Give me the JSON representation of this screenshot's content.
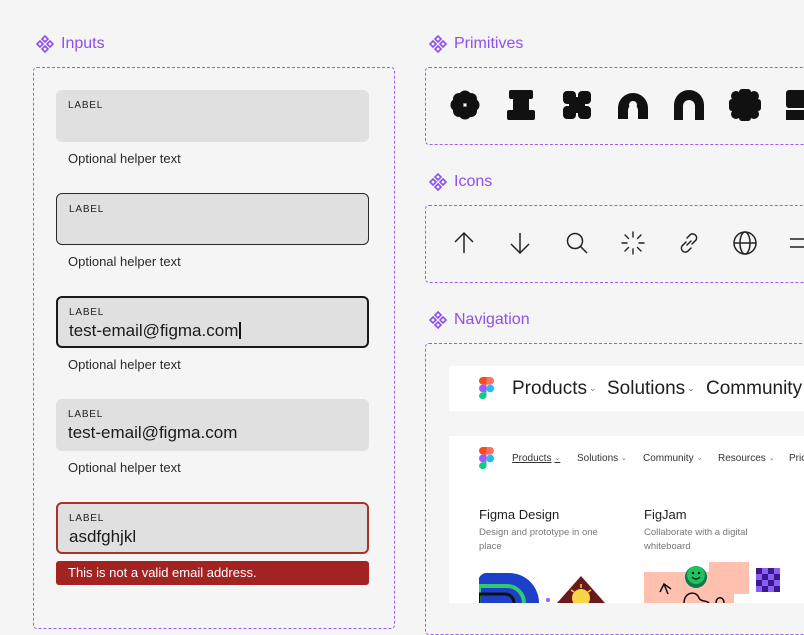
{
  "sections": {
    "inputs": "Inputs",
    "primitives": "Primitives",
    "icons": "Icons",
    "navigation": "Navigation"
  },
  "inputs": [
    {
      "label": "LABEL",
      "value": "",
      "helper": "Optional helper text",
      "state": "default"
    },
    {
      "label": "LABEL",
      "value": "",
      "helper": "Optional helper text",
      "state": "outline"
    },
    {
      "label": "LABEL",
      "value": "test-email@figma.com",
      "helper": "Optional helper text",
      "state": "focused"
    },
    {
      "label": "LABEL",
      "value": "test-email@figma.com",
      "helper": "Optional helper text",
      "state": "filled"
    },
    {
      "label": "LABEL",
      "value": "asdfghjkl",
      "error": "This is not a valid email address.",
      "state": "error"
    }
  ],
  "icons": [
    "arrow-up-icon",
    "arrow-down-icon",
    "search-icon",
    "loading-icon",
    "link-icon",
    "globe-icon",
    "menu-icon"
  ],
  "navigation": {
    "large": [
      "Products",
      "Solutions",
      "Community"
    ],
    "small": [
      "Products",
      "Solutions",
      "Community",
      "Resources",
      "Pric"
    ],
    "products": [
      {
        "title": "Figma Design",
        "desc": "Design and prototype in one place"
      },
      {
        "title": "FigJam",
        "desc": "Collaborate with a digital whiteboard"
      }
    ]
  },
  "colors": {
    "accent": "#8e4ef0",
    "error": "#a32322",
    "field": "#e0e0e0",
    "background": "#f5f5f5"
  }
}
